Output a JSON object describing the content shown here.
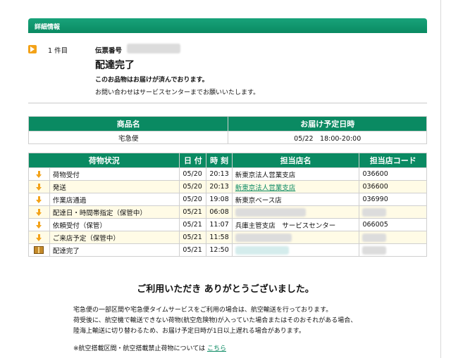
{
  "section": {
    "title": "詳細情報"
  },
  "item": {
    "count_label": "1 件目",
    "slip_label": "伝票番号",
    "status_title": "配達完了",
    "status_desc": "このお品物はお届けが済んでおります。",
    "status_note": "お問い合わせはサービスセンターまでお願いいたします。"
  },
  "product_table": {
    "headers": [
      "商品名",
      "お届け予定日時"
    ],
    "row": [
      "宅急便",
      "05/22　18:00-20:00"
    ]
  },
  "status_table": {
    "headers": [
      "荷物状況",
      "日 付",
      "時 刻",
      "担当店名",
      "担当店コード"
    ],
    "rows": [
      {
        "status": "荷物受付",
        "date": "05/20",
        "time": "20:13",
        "store": "新東京法人営業支店",
        "code": "036600",
        "icon": "down-arrow-icon"
      },
      {
        "status": "発送",
        "date": "05/20",
        "time": "20:13",
        "store": "新東京法人営業支店",
        "code": "036600",
        "icon": "down-arrow-icon"
      },
      {
        "status": "作業店通過",
        "date": "05/20",
        "time": "19:08",
        "store": "新東京ベース店",
        "code": "036990",
        "icon": "down-arrow-icon"
      },
      {
        "status": "配達日・時間帯指定（保管中）",
        "date": "05/21",
        "time": "06:08",
        "store": "",
        "code": "",
        "icon": "down-arrow-icon"
      },
      {
        "status": "依頼受付（保管）",
        "date": "05/21",
        "time": "11:07",
        "store": "兵庫主管支店　サービスセンター",
        "code": "066005",
        "icon": "down-arrow-icon"
      },
      {
        "status": "ご来店予定（保管中）",
        "date": "05/21",
        "time": "11:58",
        "store": "",
        "code": "",
        "icon": "down-arrow-icon"
      },
      {
        "status": "配達完了",
        "date": "05/21",
        "time": "12:50",
        "store": "",
        "code": "",
        "icon": "package-icon"
      }
    ]
  },
  "footer": {
    "thanks": "ご利用いただき ありがとうございました。",
    "note1": "宅急便の一部区間や宅急便タイムサービスをご利用の場合は、航空輸送を行っております。",
    "note2": "荷受後に、航空機で輸送できない荷物(航空危険物)が入っていた場合またはそのおそれがある場合、",
    "note3": "陸海上輸送に切り替わるため、お届け予定日時が1日以上遅れる場合があります。",
    "note4_prefix": "※航空搭載区間・航空搭載禁止荷物については",
    "note4_link": "こちら"
  },
  "colors": {
    "header_green": "#0a8a62",
    "arrow_orange": "#f3a218",
    "row_alt": "#fffbe6"
  }
}
